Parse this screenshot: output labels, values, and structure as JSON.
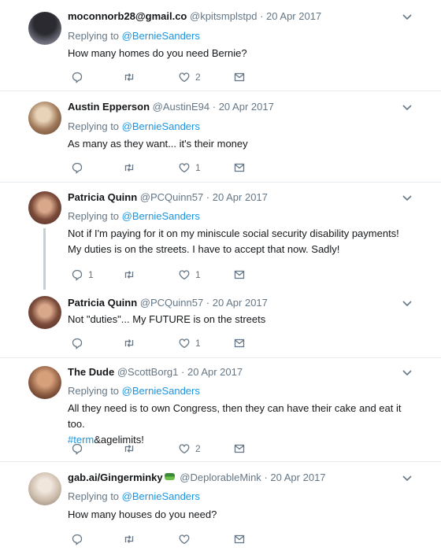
{
  "tweets": [
    {
      "name": "moconnorb28@gmail.co",
      "handle": "@kpitsmplstpd",
      "date": "20 Apr 2017",
      "replying_prefix": "Replying to",
      "replying_to": "@BernieSanders",
      "text": "How many homes do you need Bernie?",
      "replies": "",
      "retweets": "",
      "likes": "2",
      "avatar_color": "#4a4a55"
    },
    {
      "name": "Austin Epperson",
      "handle": "@AustinE94",
      "date": "20 Apr 2017",
      "replying_prefix": "Replying to",
      "replying_to": "@BernieSanders",
      "text": "As many as they want... it's their money",
      "replies": "",
      "retweets": "",
      "likes": "1",
      "avatar_color": "#a07a5a"
    },
    {
      "name": "Patricia Quinn",
      "handle": "@PCQuinn57",
      "date": "20 Apr 2017",
      "replying_prefix": "Replying to",
      "replying_to": "@BernieSanders",
      "text": "Not if I'm paying for it on my miniscule social security disability payments! My duties is on the streets. I have to accept that now. Sadly!",
      "replies": "1",
      "retweets": "",
      "likes": "1",
      "avatar_color": "#7a4a3a"
    },
    {
      "name": "Patricia Quinn",
      "handle": "@PCQuinn57",
      "date": "20 Apr 2017",
      "text": "Not \"duties\"... My FUTURE is on the streets",
      "replies": "",
      "retweets": "",
      "likes": "1",
      "avatar_color": "#7a4a3a"
    },
    {
      "name": "The Dude",
      "handle": "@ScottBorg1",
      "date": "20 Apr 2017",
      "replying_prefix": "Replying to",
      "replying_to": "@BernieSanders",
      "text_before": "All they need is to own Congress,  then they can have their cake and eat it too.",
      "hashtag": "#term",
      "text_after": "&agelimits!",
      "replies": "",
      "retweets": "",
      "likes": "2",
      "avatar_color": "#8a5a40"
    },
    {
      "name": "gab.ai/Gingerminky",
      "handle": "@DeplorableMink",
      "date": "20 Apr 2017",
      "replying_prefix": "Replying to",
      "replying_to": "@BernieSanders",
      "text": "How many houses do you need?",
      "replies": "",
      "retweets": "",
      "likes": "",
      "avatar_color": "#c9b9a8"
    }
  ],
  "separator": "·",
  "icons": {
    "reply": "reply-icon",
    "retweet": "retweet-icon",
    "like": "heart-icon",
    "message": "mail-icon",
    "more": "chevron-down-icon"
  },
  "colors": {
    "link": "#1b95e0",
    "muted": "#657786",
    "divider": "#e6ecf0"
  }
}
